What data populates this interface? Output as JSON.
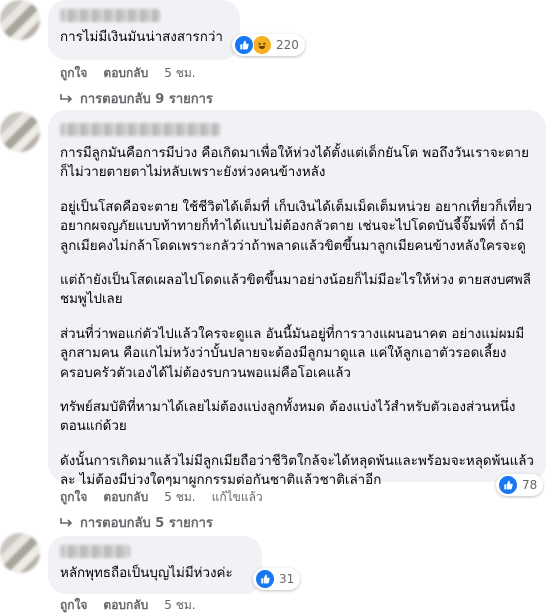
{
  "comments": [
    {
      "text": "การไม่มีเงินมันน่าสงสารกว่า",
      "reaction_count": "220",
      "like_label": "ถูกใจ",
      "reply_label": "ตอบกลับ",
      "time": "5 ชม.",
      "replies_link": "การตอบกลับ 9 รายการ"
    },
    {
      "paragraphs": [
        "การมีลูกมันคือการมีบ่วง คือเกิดมาเพื่อให้ห่วงได้ตั้งแต่เด็กยันโต พอถึงวันเราจะตายก็ไม่วายตายตาไม่หลับเพราะยังห่วงคนข้างหลัง",
        "อยู่เป็นโสดคือจะตาย ใช้ชีวิตได้เต็มที่ เก็บเงินได้เต็มเม็ดเต็มหน่วย อยากเที่ยวก็เที่ยว อยากผจญภัยแบบท้าทายก็ทำได้แบบไม่ต้องกลัวตาย เช่นจะไปโดดบันจี้จั๊มพ์ที่ ถ้ามีลูกเมียคงไม่กล้าโดดเพราะกลัวว่าถ้าพลาดแล้วขิตขึ้นมาลูกเมียคนข้างหลังใครจะดู",
        "แต่ถ้ายังเป็นโสดเผลอไปโดดแล้วขิตขึ้นมาอย่างน้อยก็ไม่มีอะไรให้ห่วง ตายสงบศพลีชมพูไปเลย",
        "ส่วนที่ว่าพอแก่ตัวไปแล้วใครจะดูแล อันนี้มันอยู่ที่การวางแผนอนาคต อย่างแม่ผมมีลูกสามคน คือแกไม่หวังว่าบั้นปลายจะต้องมีลูกมาดูแล แค่ให้ลูกเอาตัวรอดเลี้ยงครอบครัวตัวเองได้ไม่ต้องรบกวนพอแม่คือโอเคแล้ว",
        "ทรัพย์สมบัติที่หามาได้เลยไม่ต้องแบ่งลูกทั้งหมด ต้องแบ่งไว้สำหรับตัวเองส่วนหนึ่งตอนแก่ด้วย",
        "ดังนั้นการเกิดมาแล้วไม่มีลูกเมียถือว่าชีวิตใกล้จะได้หลุดพ้นและพร้อมจะหลุดพ้นแล้วละ ไม่ต้องมีบ่วงใดๆมาผูกกรรมต่อกันชาติแล้วชาติเล่าอีก"
      ],
      "reaction_count": "78",
      "like_label": "ถูกใจ",
      "reply_label": "ตอบกลับ",
      "time": "5 ชม.",
      "edited_label": "แก้ไขแล้ว",
      "replies_link": "การตอบกลับ 5 รายการ"
    },
    {
      "text": "หลักพุทธถือเป็นบุญไม่มีห่วงค่ะ",
      "reaction_count": "31",
      "like_label": "ถูกใจ",
      "reply_label": "ตอบกลับ",
      "time": "5 ชม."
    }
  ],
  "colors": {
    "bubble_bg": "#f0f2f5",
    "meta_text": "#65676b",
    "like_blue": "#1877f2",
    "haha_yellow": "#f7b125"
  }
}
